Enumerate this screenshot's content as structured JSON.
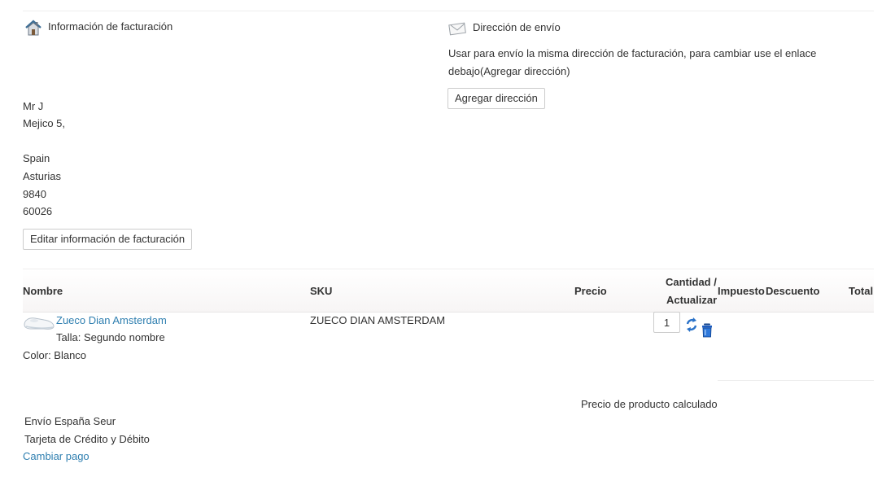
{
  "billing": {
    "title": "Información de facturación",
    "address_lines": [
      "Mr J",
      "Mejico 5,",
      "",
      "Spain",
      "Asturias",
      "9840",
      "60026"
    ],
    "edit_button": "Editar información de facturación",
    "icon": "house-icon"
  },
  "shipping": {
    "title": "Dirección de envío",
    "note": "Usar para envío la misma dirección de facturación, para cambiar use el enlace debajo(Agregar dirección)",
    "note_line1": "Usar para envío la misma dirección de facturación, para cambiar use el enlace",
    "note_line2": "debajo(Agregar dirección)",
    "add_button": "Agregar dirección",
    "icon": "envelope-icon"
  },
  "table": {
    "headers": {
      "name": "Nombre",
      "sku": "SKU",
      "price": "Precio",
      "quantity_line1": "Cantidad /",
      "quantity_line2": "Actualizar",
      "tax": "Impuesto",
      "discount": "Descuento",
      "total": "Total"
    },
    "rows": [
      {
        "product_name": "Zueco Dian Amsterdam",
        "size": "Talla: Segundo nombre",
        "color": "Color: Blanco",
        "sku": "ZUECO DIAN AMSTERDAM",
        "quantity": "1",
        "update_icon": "refresh-icon",
        "delete_icon": "trash-icon"
      }
    ]
  },
  "summary": {
    "price_calculated": "Precio de producto calculado",
    "shipping_method": "Envío España Seur",
    "payment_method": "Tarjeta de Crédito y Débito",
    "change_payment": "Cambiar pago"
  }
}
